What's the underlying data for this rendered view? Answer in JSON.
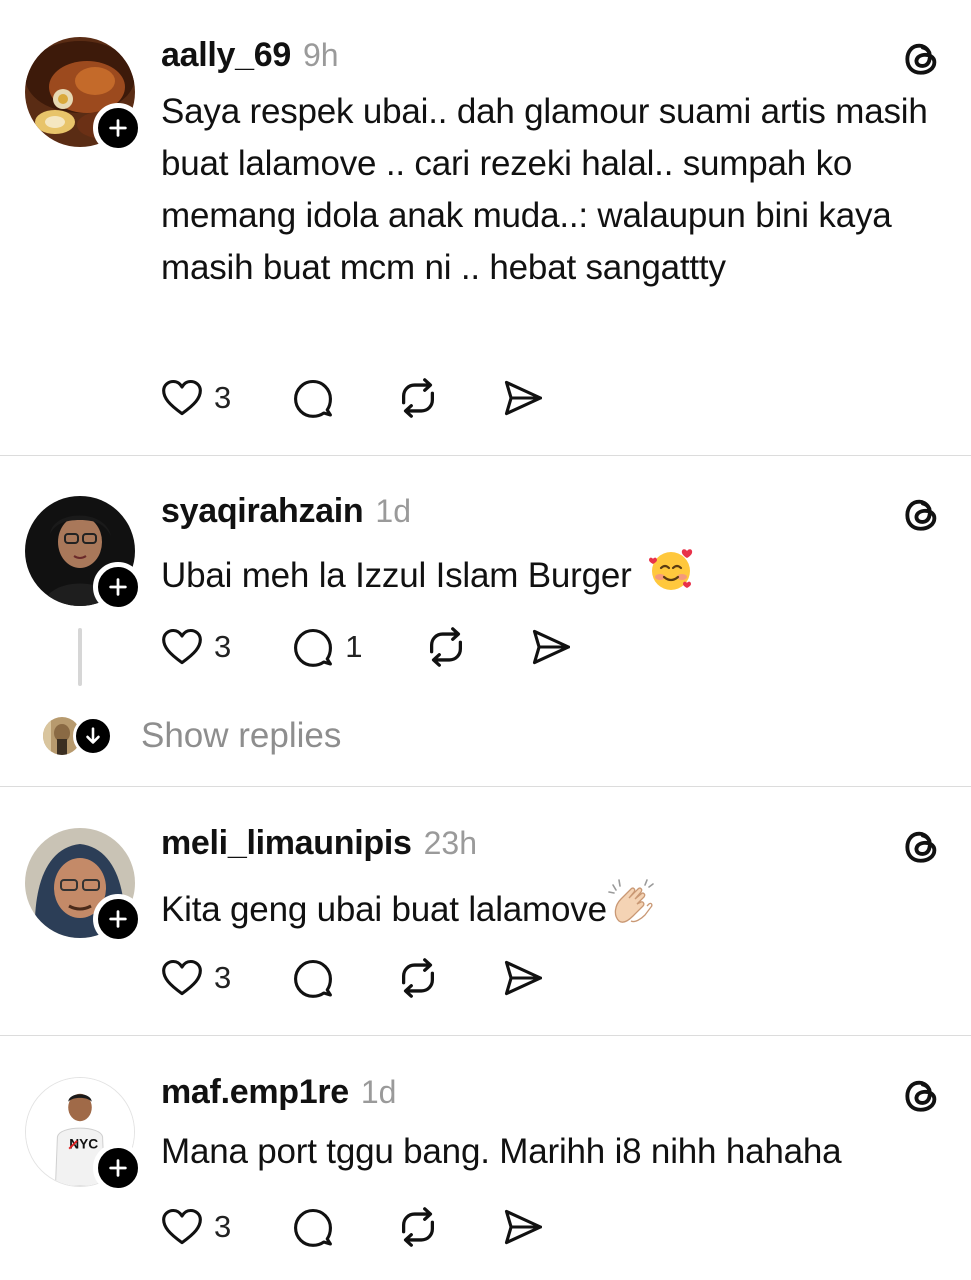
{
  "posts": [
    {
      "username": "aally_69",
      "time": "9h",
      "text": "Saya respek ubai.. dah glamour suami artis masih buat lalamove .. cari rezeki halal.. sumpah ko memang idola anak muda..: walaupun bini kaya masih buat mcm ni .. hebat sangattty",
      "likes": "3",
      "replies": ""
    },
    {
      "username": "syaqirahzain",
      "time": "1d",
      "text": "Ubai meh la Izzul Islam Burger",
      "likes": "3",
      "replies": "1"
    },
    {
      "username": "meli_limaunipis",
      "time": "23h",
      "text": "Kita geng ubai buat lalamove",
      "likes": "3",
      "replies": ""
    },
    {
      "username": "maf.emp1re",
      "time": "1d",
      "text": "Mana port tggu bang. Marihh i8 nihh hahaha",
      "likes": "3",
      "replies": ""
    }
  ],
  "show_replies": "Show replies",
  "icons": {
    "like": "heart-icon",
    "reply": "comment-bubble-icon",
    "repost": "repost-icon",
    "share": "send-icon",
    "app": "threads-logo-icon",
    "follow": "plus-icon",
    "expand": "arrow-down-icon"
  },
  "emojis": {
    "post_2": "smiling-face-with-hearts",
    "post_3": "clapping-hands"
  }
}
